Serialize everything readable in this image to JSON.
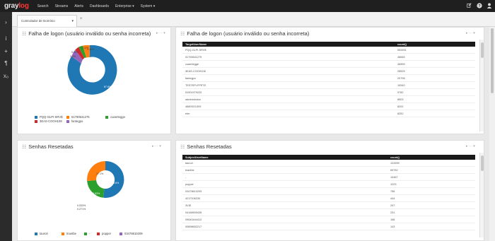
{
  "app": {
    "logo_left": "gray",
    "logo_right": "log"
  },
  "nav": {
    "items": [
      "Search",
      "Streams",
      "Alerts",
      "Dashboards",
      "Enterprise ▾",
      "System ▾"
    ]
  },
  "tabs": {
    "active": "Controlador de Domínio",
    "add": "+"
  },
  "panels": {
    "pie_logon": {
      "title": "Falha de logon (usuário inválido ou senha incorreta)",
      "labels": {
        "big": "87.8%",
        "l1": "5.63%",
        "l2": "3.4%",
        "l3": "2.48%",
        "l4": "1.14%"
      },
      "legend": [
        "PQQ-GLPI-SRV$",
        "51790641275",
        "cuanrtegge",
        "3EAS-COOH108",
        "fantegpo"
      ]
    },
    "table_logon": {
      "title": "Falha de logon (usuário inválido ou senha incorreta)",
      "header": [
        "TargetUserName",
        "count()"
      ],
      "rows": [
        [
          "PQQ-GLPI-SRV$",
          "552691"
        ],
        [
          "51790641275",
          "46846"
        ],
        [
          "cuanrtegge",
          "46559"
        ],
        [
          "3EAS-COOH108",
          "28529"
        ],
        [
          "fantegpo",
          "20796"
        ],
        [
          "TESTEPLFPETE",
          "15340"
        ],
        [
          "51901979220",
          "9782"
        ],
        [
          "administrator",
          "8503"
        ],
        [
          "4680SG1393",
          "8202"
        ],
        [
          "eier",
          "8252"
        ]
      ]
    },
    "pie_senhas": {
      "title": "Senhas Resetadas",
      "labels": {
        "big": "63.6%",
        "orange": "27.1%",
        "green": "8.53%",
        "l1": "0.533%",
        "l2": "0.271%"
      },
      "legend": [
        "taurori",
        "tnantbe",
        "-",
        "popper",
        "03478610209"
      ]
    },
    "table_senhas": {
      "title": "Senhas Resetadas",
      "header": [
        "SubjectUserName",
        "count()"
      ],
      "rows": [
        [
          "taurori",
          "122699"
        ],
        [
          "tnantbe",
          "69752"
        ],
        [
          "-",
          "10467"
        ],
        [
          "popper",
          "1223"
        ],
        [
          "03478610209",
          "756"
        ],
        [
          "4217106230",
          "444"
        ],
        [
          "3VIE",
          "297"
        ],
        [
          "04168909435",
          "231"
        ],
        [
          "09640444412",
          "168"
        ],
        [
          "00898652217",
          "143"
        ]
      ]
    }
  },
  "colors": {
    "blue": "#1f77b4",
    "orange": "#ff7f0e",
    "green": "#2ca02c",
    "red": "#d62728",
    "purple": "#9467bd",
    "logo_red": "#ff3633"
  },
  "icons": {
    "navbar_right": [
      "pencil-icon",
      "help-icon",
      "user-icon",
      "logout-icon"
    ],
    "sidebar": [
      "chevron-right-icon",
      "info-icon",
      "plus-icon",
      "flag-icon",
      "x-subscript-icon"
    ]
  }
}
